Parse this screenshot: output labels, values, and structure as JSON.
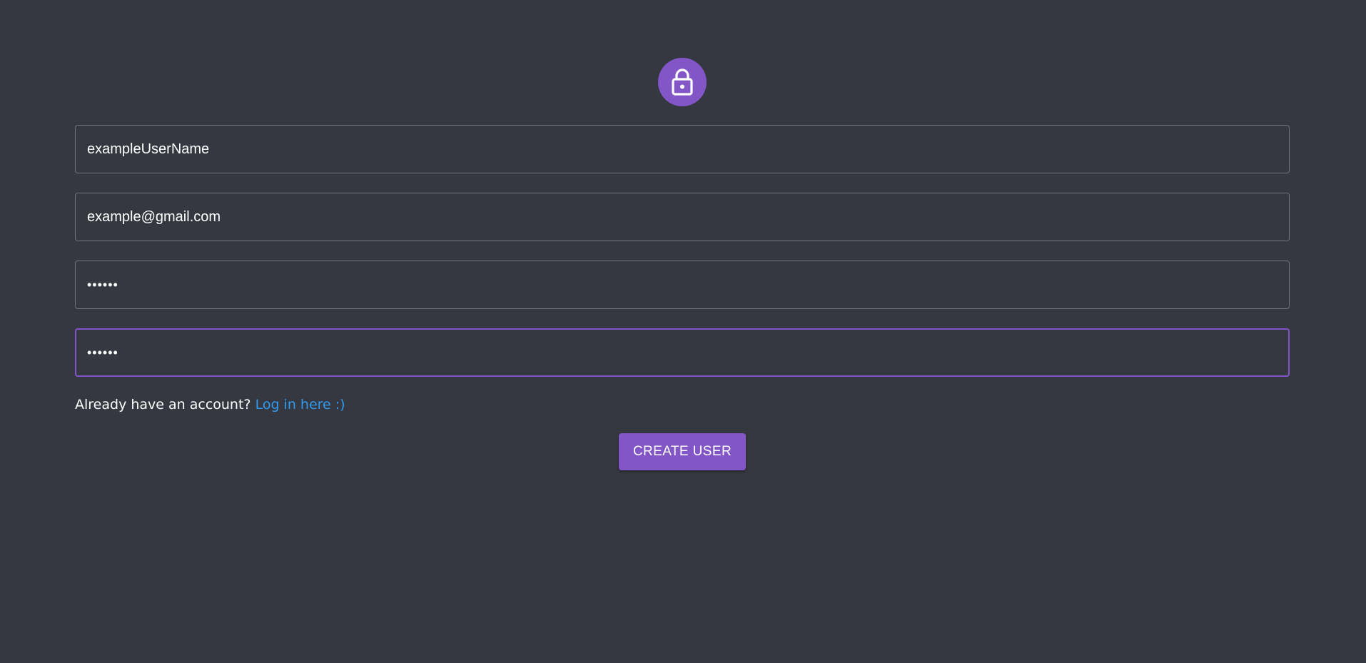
{
  "header": {
    "icon": "lock-icon",
    "accent_color": "#8356c8"
  },
  "form": {
    "username": {
      "value": "exampleUserName"
    },
    "email": {
      "value": "example@gmail.com"
    },
    "password": {
      "value": "••••••"
    },
    "confirm_password": {
      "value": "••••••"
    }
  },
  "login_prompt": {
    "text": "Already have an account?",
    "link": "Log in here :)"
  },
  "actions": {
    "create_user_label": "CREATE USER"
  }
}
